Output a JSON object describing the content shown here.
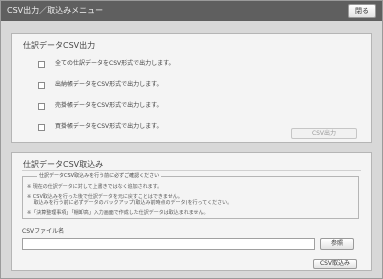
{
  "window": {
    "title": "CSV出力／取込みメニュー",
    "close_label": "閉る"
  },
  "export": {
    "title": "仕訳データCSV出力",
    "options": [
      {
        "label": "全ての仕訳データをCSV形式で出力します。"
      },
      {
        "label": "出納帳データをCSV形式で出力します。"
      },
      {
        "label": "売掛帳データをCSV形式で出力します。"
      },
      {
        "label": "買掛帳データをCSV形式で出力します。"
      }
    ],
    "button_label": "CSV出力"
  },
  "import": {
    "title": "仕訳データCSV取込み",
    "notice_title": "仕訳データCSV取込みを行う前に必ずご確認ください",
    "notes": [
      "※ 現在の仕訳データに対して上書きではなく追加されます。",
      "※ CSV取込みを行った後で仕訳データを元に戻すことはできません。",
      "　 取込みを行う前に必ずデータのバックアップ(取込み前時点のデータ)を行ってください。",
      "※「決算整理事項」「棚卸高」入力画面で作成した仕訳データは取込まれません。"
    ],
    "file_label": "CSVファイル名",
    "file_value": "",
    "browse_label": "参照",
    "button_label": "CSV取込み"
  }
}
